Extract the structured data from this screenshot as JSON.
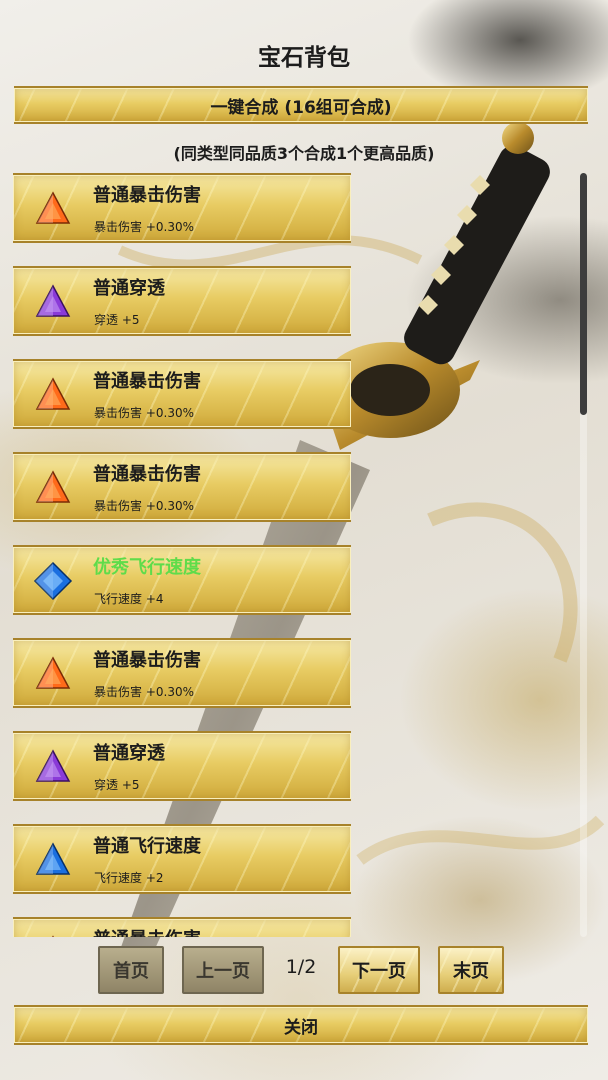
{
  "title": "宝石背包",
  "merge_button": "一键合成 (16组可合成)",
  "hint": "(同类型同品质3个合成1个更高品质)",
  "gems": [
    {
      "name": "普通暴击伤害",
      "stat": "暴击伤害 +0.30%",
      "icon": "orange-triangle-gem-icon",
      "color": "#ff6a1a",
      "rare": false
    },
    {
      "name": "普通穿透",
      "stat": "穿透 +5",
      "icon": "purple-triangle-gem-icon",
      "color": "#8a3ad8",
      "rare": false
    },
    {
      "name": "普通暴击伤害",
      "stat": "暴击伤害 +0.30%",
      "icon": "orange-triangle-gem-icon",
      "color": "#ff6a1a",
      "rare": false
    },
    {
      "name": "普通暴击伤害",
      "stat": "暴击伤害 +0.30%",
      "icon": "orange-triangle-gem-icon",
      "color": "#ff6a1a",
      "rare": false
    },
    {
      "name": "优秀飞行速度",
      "stat": "飞行速度 +4",
      "icon": "blue-diamond-gem-icon",
      "color": "#1a6fe0",
      "rare": true
    },
    {
      "name": "普通暴击伤害",
      "stat": "暴击伤害 +0.30%",
      "icon": "orange-triangle-gem-icon",
      "color": "#ff6a1a",
      "rare": false
    },
    {
      "name": "普通穿透",
      "stat": "穿透 +5",
      "icon": "purple-triangle-gem-icon",
      "color": "#8a3ad8",
      "rare": false
    },
    {
      "name": "普通飞行速度",
      "stat": "飞行速度 +2",
      "icon": "blue-triangle-gem-icon",
      "color": "#1a6fe0",
      "rare": false
    },
    {
      "name": "普通暴击伤害",
      "stat": "",
      "icon": "orange-triangle-gem-icon",
      "color": "#ff6a1a",
      "rare": false
    }
  ],
  "pagination": {
    "first": "首页",
    "prev": "上一页",
    "indicator": "1/2",
    "next": "下一页",
    "last": "末页"
  },
  "close_button": "关闭"
}
